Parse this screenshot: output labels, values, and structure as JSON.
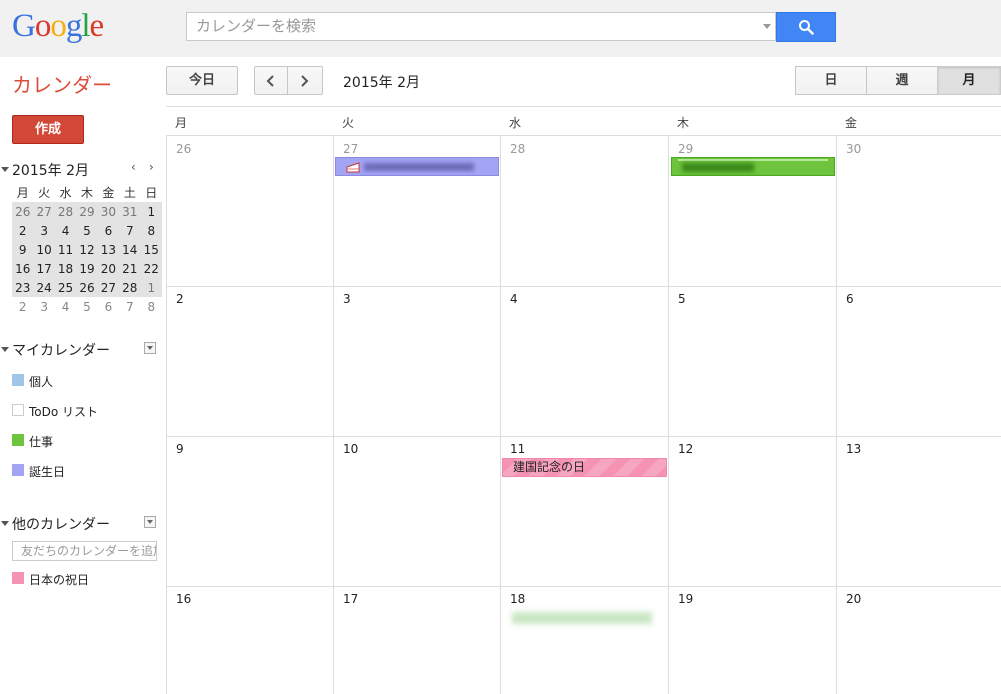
{
  "header": {
    "logo": [
      "G",
      "o",
      "o",
      "g",
      "l",
      "e"
    ],
    "search_placeholder": "カレンダーを検索",
    "app_title": "カレンダー"
  },
  "toolbar": {
    "today_label": "今日",
    "current_period": "2015年 2月",
    "views": [
      {
        "label": "日",
        "active": false
      },
      {
        "label": "週",
        "active": false
      },
      {
        "label": "月",
        "active": true
      }
    ]
  },
  "sidebar": {
    "create_label": "作成",
    "minical": {
      "title": "2015年 2月",
      "prev": "‹",
      "next": "›",
      "weekdays": [
        "月",
        "火",
        "水",
        "木",
        "金",
        "土",
        "日"
      ],
      "weeks": [
        [
          "26",
          "27",
          "28",
          "29",
          "30",
          "31",
          "1"
        ],
        [
          "2",
          "3",
          "4",
          "5",
          "6",
          "7",
          "8"
        ],
        [
          "9",
          "10",
          "11",
          "12",
          "13",
          "14",
          "15"
        ],
        [
          "16",
          "17",
          "18",
          "19",
          "20",
          "21",
          "22"
        ],
        [
          "23",
          "24",
          "25",
          "26",
          "27",
          "28",
          "1"
        ],
        [
          "2",
          "3",
          "4",
          "5",
          "6",
          "7",
          "8"
        ]
      ]
    },
    "my_calendars": {
      "title": "マイカレンダー",
      "items": [
        {
          "name": "個人",
          "color": "#9fc6e7"
        },
        {
          "name": "ToDo リスト",
          "color": "#ffffff"
        },
        {
          "name": "仕事",
          "color": "#6ec43c"
        },
        {
          "name": "誕生日",
          "color": "#a4a4f5"
        }
      ]
    },
    "other_calendars": {
      "title": "他のカレンダー",
      "add_placeholder": "友だちのカレンダーを追加",
      "items": [
        {
          "name": "日本の祝日",
          "color": "#f593b2"
        }
      ]
    }
  },
  "month": {
    "weekday_headers": [
      "月",
      "火",
      "水",
      "木",
      "金"
    ],
    "weeks": [
      [
        "26",
        "27",
        "28",
        "29",
        "30"
      ],
      [
        "2",
        "3",
        "4",
        "5",
        "6"
      ],
      [
        "9",
        "10",
        "11",
        "12",
        "13"
      ],
      [
        "16",
        "17",
        "18",
        "19",
        "20"
      ]
    ],
    "holiday_event": "建国記念の日"
  },
  "colors": {
    "accent_red": "#dd4b39",
    "search_blue": "#4285f4",
    "birthday": "#a4a4f5",
    "work": "#6ec43c",
    "holiday": "#f593b2"
  }
}
